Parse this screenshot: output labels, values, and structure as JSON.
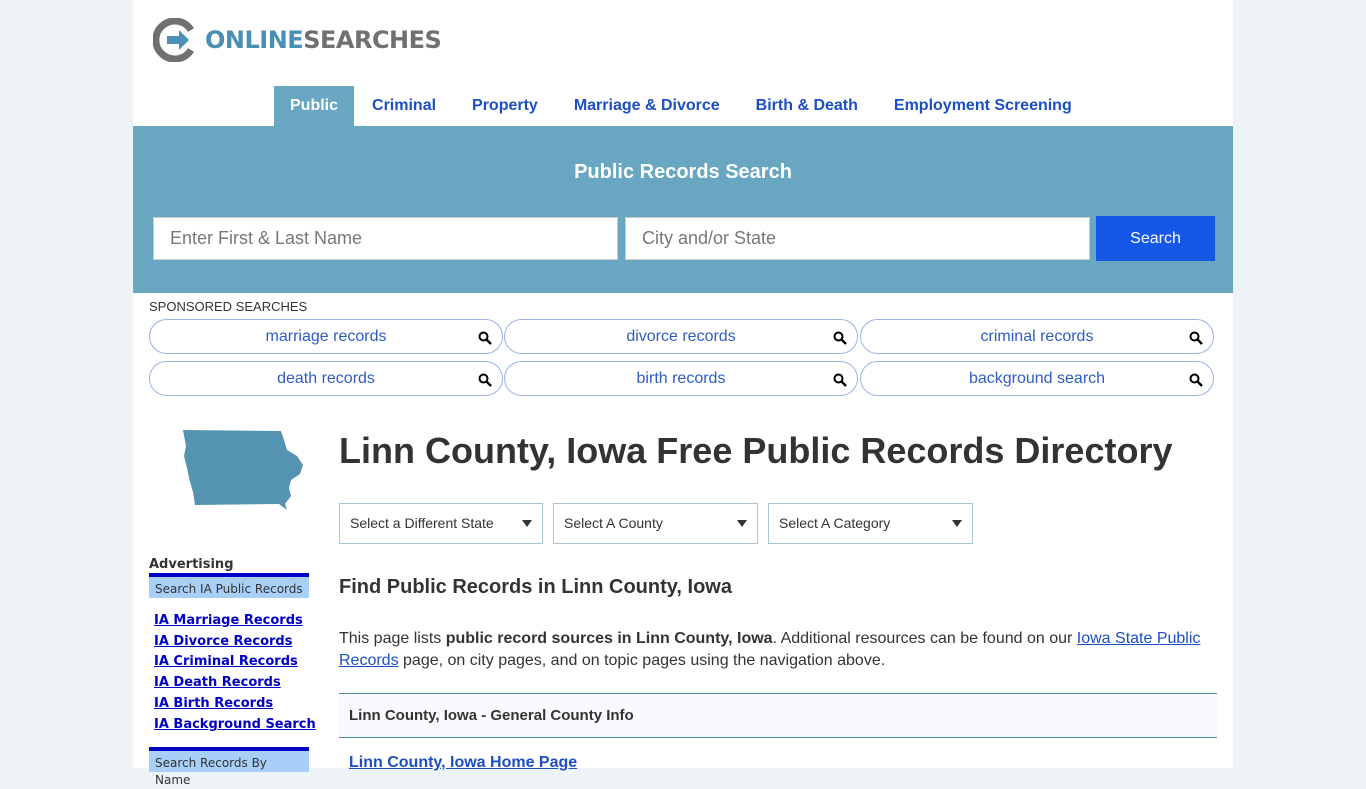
{
  "logo": {
    "part1": "ONLINE",
    "part2": "SEARCHES"
  },
  "nav": [
    {
      "label": "Public",
      "active": true
    },
    {
      "label": "Criminal"
    },
    {
      "label": "Property"
    },
    {
      "label": "Marriage & Divorce"
    },
    {
      "label": "Birth & Death"
    },
    {
      "label": "Employment Screening"
    }
  ],
  "search": {
    "title": "Public Records Search",
    "name_placeholder": "Enter First & Last Name",
    "location_placeholder": "City and/or State",
    "button": "Search"
  },
  "sponsored": {
    "label": "SPONSORED SEARCHES",
    "items": [
      "marriage records",
      "divorce records",
      "criminal records",
      "death records",
      "birth records",
      "background search"
    ]
  },
  "sidebar": {
    "advertising": "Advertising",
    "box1": "Search IA Public Records",
    "links": [
      "IA Marriage Records",
      "IA Divorce Records",
      "IA Criminal Records",
      "IA Death Records",
      "IA Birth Records",
      "IA Background Search"
    ],
    "box2": "Search Records By Name"
  },
  "main": {
    "title": "Linn County, Iowa Free Public Records Directory",
    "selects": [
      "Select a Different State",
      "Select A County",
      "Select A Category"
    ],
    "subtitle": "Find Public Records in Linn County, Iowa",
    "intro_pre": "This page lists ",
    "intro_bold": "public record sources in Linn County, Iowa",
    "intro_mid": ". Additional resources can be found on our ",
    "intro_link": "Iowa State Public Records",
    "intro_post": " page, on city pages, and on topic pages using the navigation above.",
    "section_header": "Linn County, Iowa - General County Info",
    "first_link": "Linn County, Iowa Home Page"
  }
}
